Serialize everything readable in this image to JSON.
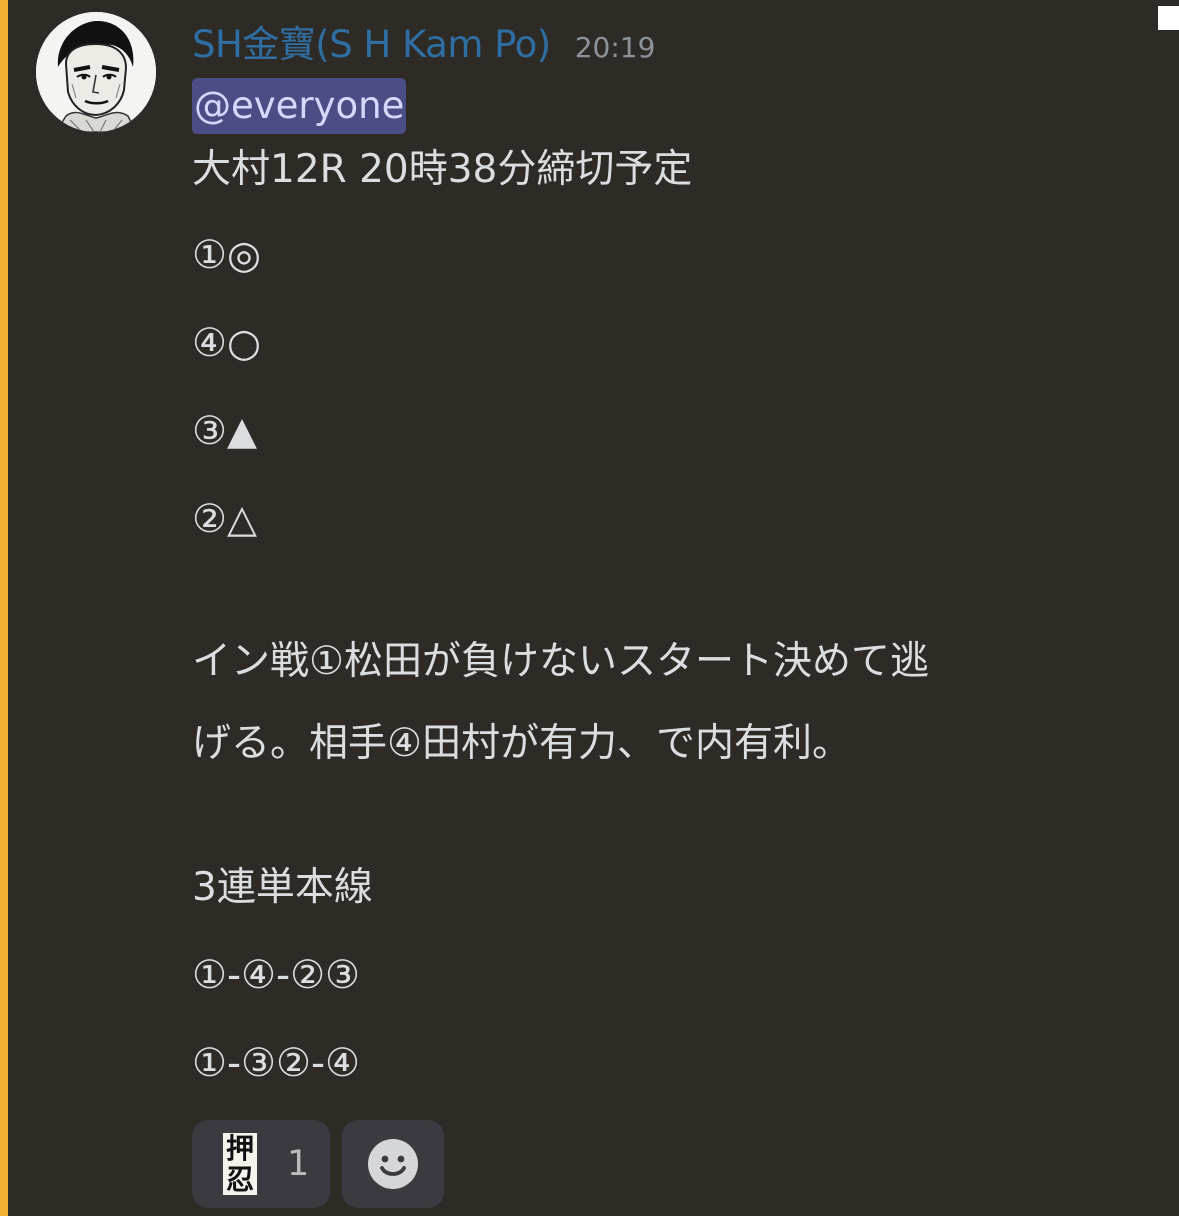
{
  "message": {
    "author": "SH金寶(S H Kam Po)",
    "timestamp": "20:19",
    "mention": "@everyone",
    "lines": [
      "大村12R 20時38分締切予定",
      "①◎",
      "④○",
      "③▲",
      "②△",
      "イン戦①松田が負けないスタート決めて逃",
      "げる。相手④田村が有力、で内有利。",
      "3連単本線",
      "①-④-②③",
      "①-③②-④"
    ]
  },
  "reactions": [
    {
      "emoji_text": "押忍",
      "count": "1"
    }
  ],
  "icons": {
    "add_reaction": "smiley-face-icon",
    "avatar": "manga-portrait-avatar"
  },
  "colors": {
    "background": "#2e2b26",
    "highlight_bar": "#f0b232",
    "username": "#2f6ea3",
    "mention_bg": "#4c4d85",
    "mention_text": "#d6d9ff",
    "reaction_bg": "#3a3a40"
  }
}
